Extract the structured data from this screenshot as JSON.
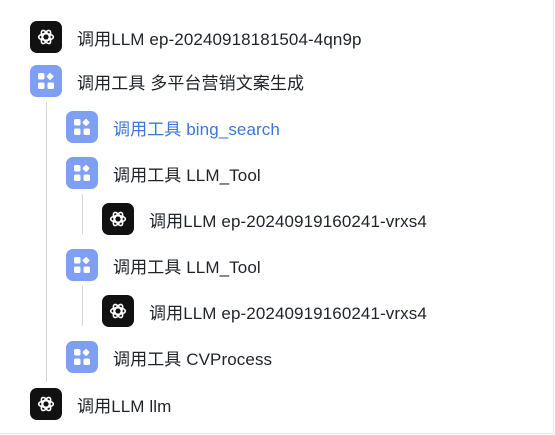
{
  "trace_tree": {
    "items": [
      {
        "type": "llm",
        "icon": "openai-icon",
        "prefix": "调用LLM",
        "name": "ep-20240918181504-4qn9p"
      },
      {
        "type": "tool",
        "icon": "tool-icon",
        "prefix": "调用工具",
        "name": "多平台营销文案生成"
      },
      {
        "type": "tool",
        "icon": "tool-icon",
        "prefix": "调用工具",
        "name": "bing_search",
        "selected": true
      },
      {
        "type": "tool",
        "icon": "tool-icon",
        "prefix": "调用工具",
        "name": "LLM_Tool"
      },
      {
        "type": "llm",
        "icon": "openai-icon",
        "prefix": "调用LLM",
        "name": "ep-20240919160241-vrxs4"
      },
      {
        "type": "tool",
        "icon": "tool-icon",
        "prefix": "调用工具",
        "name": "LLM_Tool"
      },
      {
        "type": "llm",
        "icon": "openai-icon",
        "prefix": "调用LLM",
        "name": "ep-20240919160241-vrxs4"
      },
      {
        "type": "tool",
        "icon": "tool-icon",
        "prefix": "调用工具",
        "name": "CVProcess"
      },
      {
        "type": "llm",
        "icon": "openai-icon",
        "prefix": "调用LLM",
        "name": "llm"
      }
    ]
  },
  "colors": {
    "llm_icon_bg": "#111111",
    "tool_icon_bg": "#7f9ff2",
    "selected_text": "#3b78d8",
    "tree_line": "#d3d6dc"
  }
}
